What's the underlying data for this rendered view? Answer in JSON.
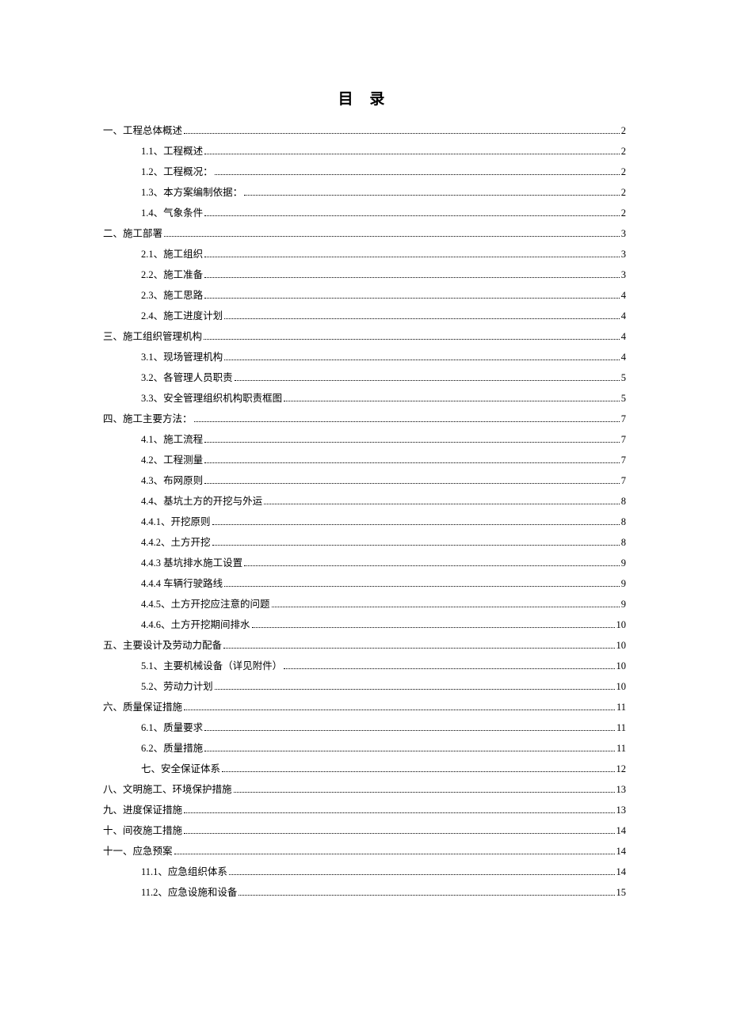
{
  "title": "目 录",
  "entries": [
    {
      "level": 0,
      "label": "一、工程总体概述",
      "page": "2"
    },
    {
      "level": 1,
      "label": "1.1、工程概述",
      "page": "2"
    },
    {
      "level": 1,
      "label": "1.2、工程概况：",
      "page": "2"
    },
    {
      "level": 1,
      "label": "1.3、本方案编制依据：",
      "page": "2"
    },
    {
      "level": 1,
      "label": "1.4、气象条件",
      "page": "2"
    },
    {
      "level": 0,
      "label": "二、施工部署",
      "page": "3"
    },
    {
      "level": 1,
      "label": "2.1、施工组织",
      "page": "3"
    },
    {
      "level": 1,
      "label": "2.2、施工准备",
      "page": "3"
    },
    {
      "level": 1,
      "label": "2.3、施工思路",
      "page": "4"
    },
    {
      "level": 1,
      "label": "2.4、施工进度计划",
      "page": "4"
    },
    {
      "level": 0,
      "label": "三、施工组织管理机构",
      "page": "4"
    },
    {
      "level": 1,
      "label": "3.1、现场管理机构",
      "page": "4"
    },
    {
      "level": 1,
      "label": "3.2、各管理人员职责",
      "page": "5"
    },
    {
      "level": 1,
      "label": "3.3、安全管理组织机构职责框图",
      "page": "5"
    },
    {
      "level": 0,
      "label": "四、施工主要方法：",
      "page": "7"
    },
    {
      "level": 1,
      "label": "4.1、施工流程",
      "page": "7"
    },
    {
      "level": 1,
      "label": "4.2、工程测量",
      "page": "7"
    },
    {
      "level": 1,
      "label": "4.3、布网原则",
      "page": "7"
    },
    {
      "level": 1,
      "label": "4.4、基坑土方的开挖与外运",
      "page": "8"
    },
    {
      "level": 1,
      "label": "4.4.1、开挖原则",
      "page": "8"
    },
    {
      "level": 1,
      "label": "4.4.2、土方开挖",
      "page": "8"
    },
    {
      "level": 1,
      "label": "4.4.3 基坑排水施工设置",
      "page": "9"
    },
    {
      "level": 1,
      "label": "4.4.4 车辆行驶路线",
      "page": "9"
    },
    {
      "level": 1,
      "label": "4.4.5、土方开挖应注意的问题",
      "page": "9"
    },
    {
      "level": 1,
      "label": "4.4.6、土方开挖期间排水",
      "page": "10"
    },
    {
      "level": 0,
      "label": "五、主要设计及劳动力配备",
      "page": "10"
    },
    {
      "level": 1,
      "label": "5.1、主要机械设备（详见附件）",
      "page": "10"
    },
    {
      "level": 1,
      "label": "5.2、劳动力计划",
      "page": "10"
    },
    {
      "level": 0,
      "label": "六、质量保证措施",
      "page": "11"
    },
    {
      "level": 1,
      "label": "6.1、质量要求",
      "page": "11"
    },
    {
      "level": 1,
      "label": "6.2、质量措施",
      "page": "11"
    },
    {
      "level": 1,
      "label": "七、安全保证体系",
      "page": "12"
    },
    {
      "level": 0,
      "label": "八、文明施工、环境保护措施",
      "page": "13"
    },
    {
      "level": 0,
      "label": "九、进度保证措施",
      "page": "13"
    },
    {
      "level": 0,
      "label": "十、间夜施工措施",
      "page": "14"
    },
    {
      "level": 0,
      "label": "十一、应急预案",
      "page": "14"
    },
    {
      "level": 1,
      "label": "11.1、应急组织体系",
      "page": "14"
    },
    {
      "level": 1,
      "label": "11.2、应急设施和设备",
      "page": "15"
    }
  ]
}
